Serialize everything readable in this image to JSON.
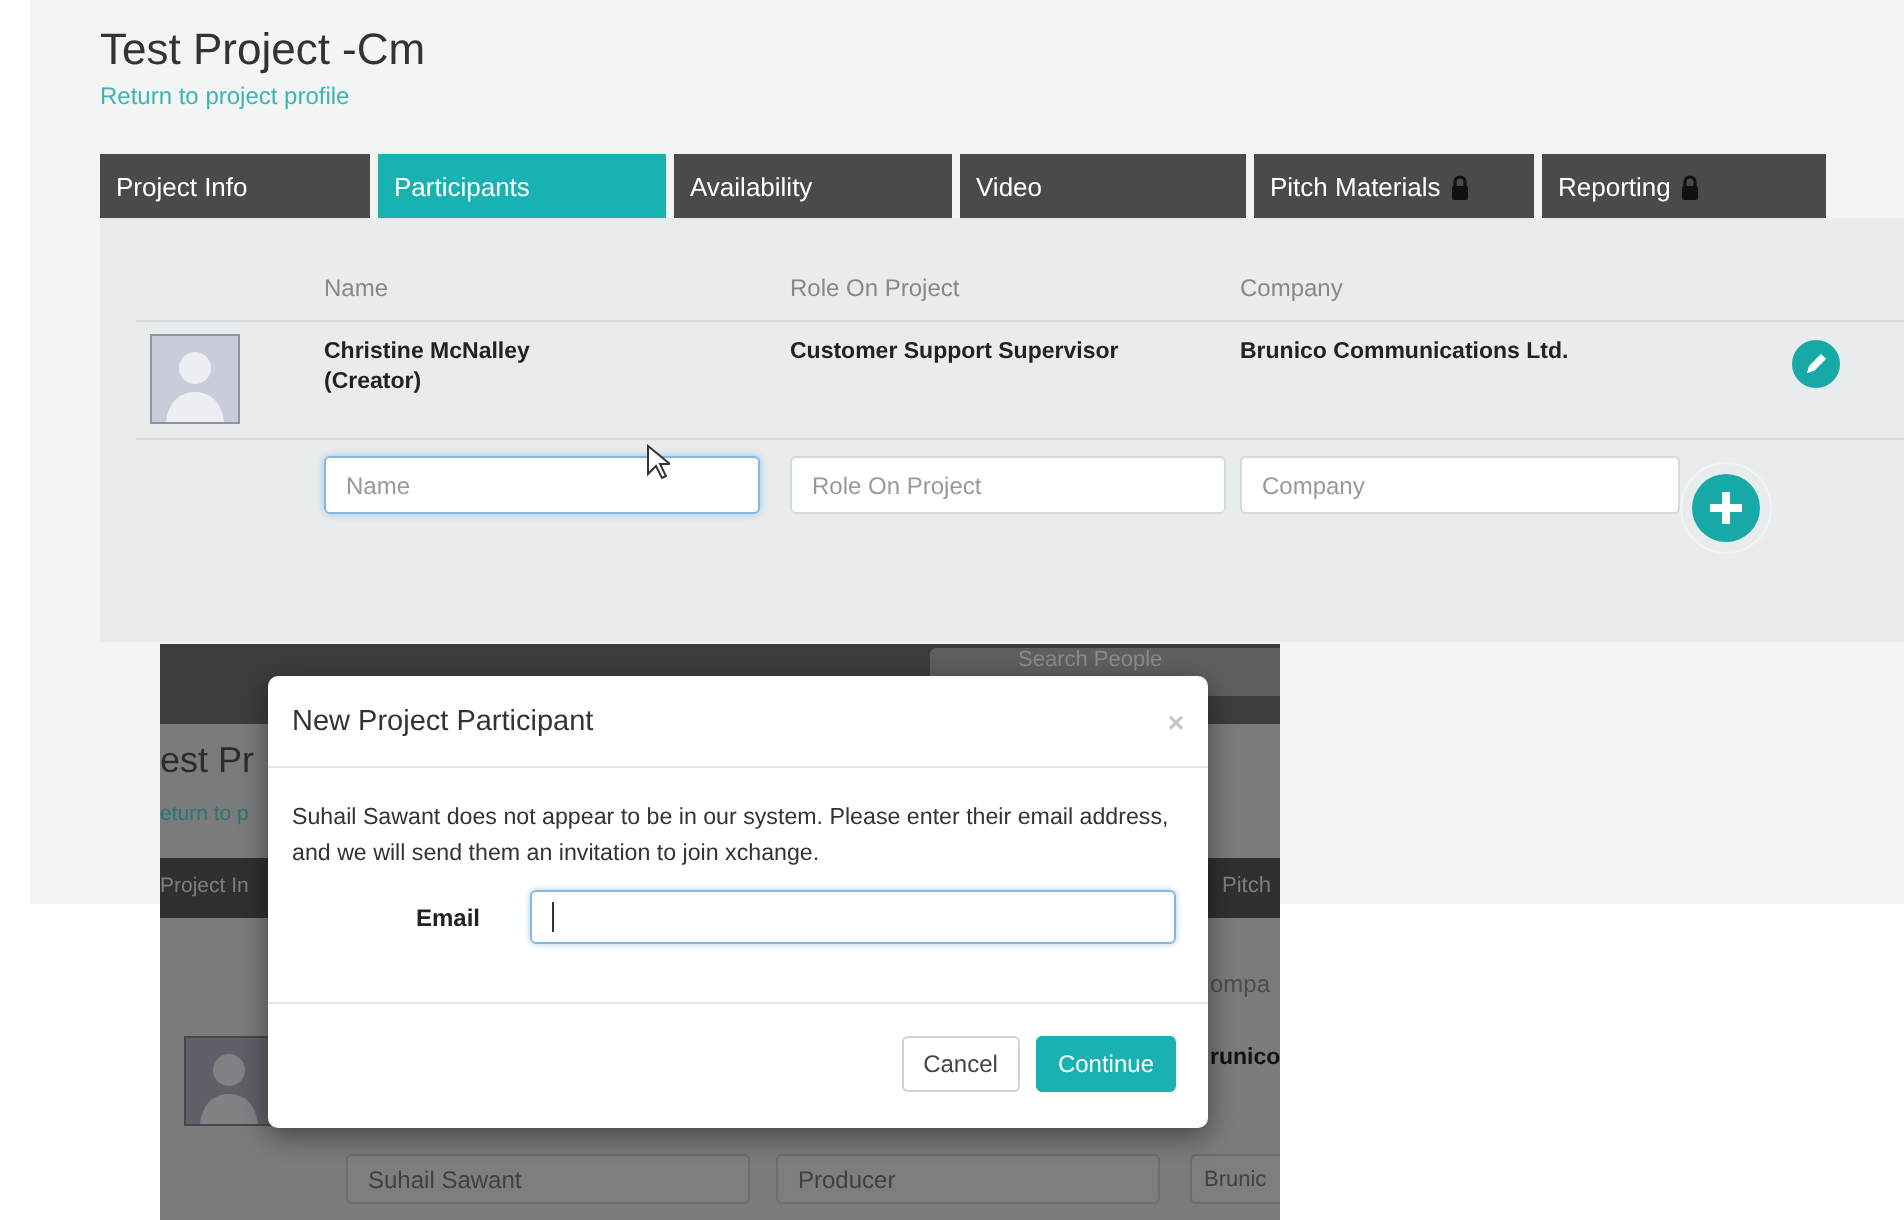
{
  "page": {
    "title": "Test Project -Cm",
    "back_link": "Return to project profile"
  },
  "tabs": [
    {
      "label": "Project Info",
      "selected": false,
      "locked": false
    },
    {
      "label": "Participants",
      "selected": true,
      "locked": false
    },
    {
      "label": "Availability",
      "selected": false,
      "locked": false
    },
    {
      "label": "Video",
      "selected": false,
      "locked": false
    },
    {
      "label": "Pitch Materials",
      "selected": false,
      "locked": true
    },
    {
      "label": "Reporting",
      "selected": false,
      "locked": true
    }
  ],
  "table": {
    "columns": [
      "Name",
      "Role On Project",
      "Company"
    ],
    "rows": [
      {
        "name": "Christine McNalley",
        "note": "(Creator)",
        "role": "Customer Support Supervisor",
        "company": "Brunico Communications Ltd."
      }
    ],
    "new_row": [
      {
        "placeholder": "Name",
        "focused": true
      },
      {
        "placeholder": "Role On Project",
        "focused": false
      },
      {
        "placeholder": "Company",
        "focused": false
      }
    ]
  },
  "inset": {
    "search_placeholder": "Search People",
    "title_fragment": "est Pr",
    "link_fragment": "eturn to p",
    "tab_fragments": [
      "Project In",
      "Pitch"
    ],
    "column_fragment": "ompa",
    "company_fragment": "runico",
    "row_fields": [
      "Suhail Sawant",
      "Producer",
      "Brunic"
    ],
    "modal": {
      "title": "New Project Participant",
      "close": "×",
      "message": "Suhail Sawant does not appear to be in our system. Please enter their email address, and we will send them an invitation to join xchange.",
      "email_label": "Email",
      "buttons": [
        {
          "label": "Cancel",
          "kind": "secondary"
        },
        {
          "label": "Continue",
          "kind": "primary"
        }
      ]
    }
  }
}
